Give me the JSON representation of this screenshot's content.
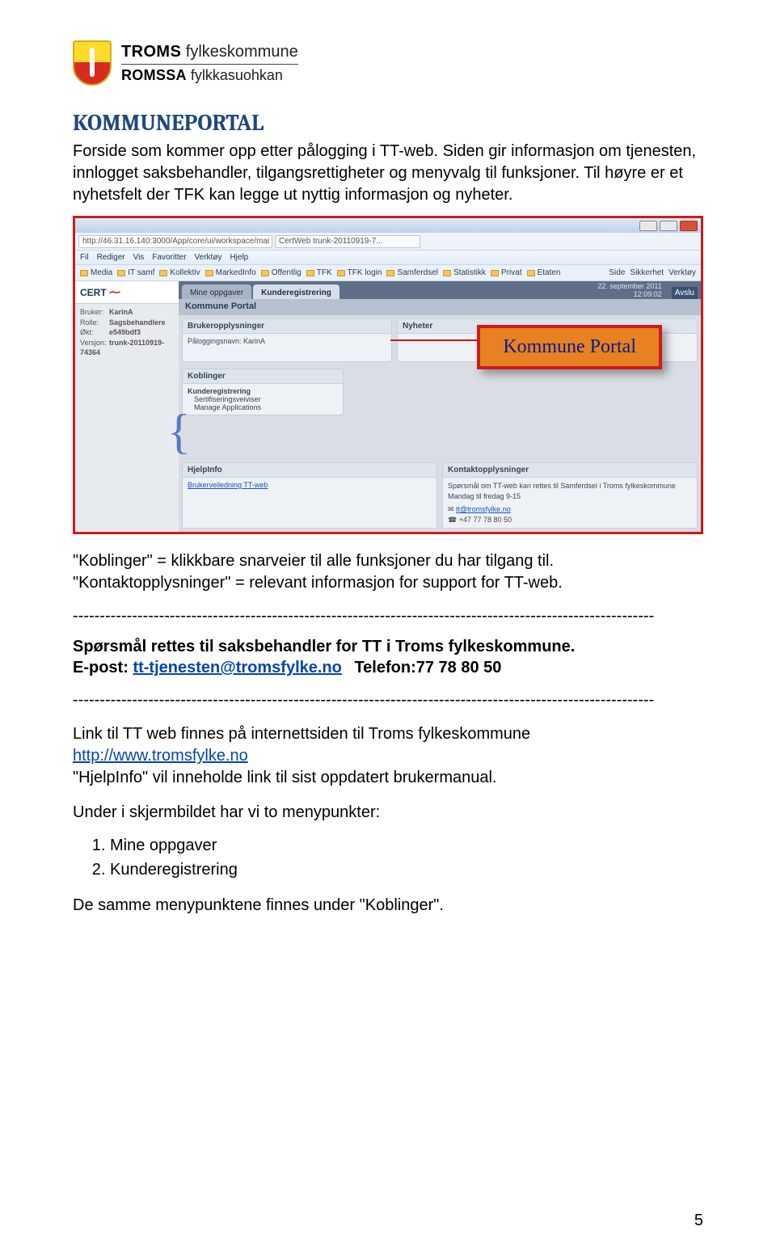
{
  "logo": {
    "line1_bold": "TROMS",
    "line1_rest": " fylkeskommune",
    "line2_bold": "ROMSSA",
    "line2_rest": " fylkkasuohkan"
  },
  "title": "KOMMUNEPORTAL",
  "intro": "Forside som kommer opp etter pålogging i TT-web. Siden gir informasjon om tjenesten, innlogget saksbehandler, tilgangsrettigheter og menyvalg til funksjoner. Til høyre er et nyhetsfelt der TFK kan legge ut nyttig informasjon og nyheter.",
  "browser": {
    "url": "http://46.31.16.140:3000/App/core/ui/workspace/mai",
    "tab_title": "CertWeb trunk-20110919-7...",
    "menus": [
      "Fil",
      "Rediger",
      "Vis",
      "Favoritter",
      "Verktøy",
      "Hjelp"
    ],
    "bookmarks_left": [
      "Media",
      "IT samf",
      "Kollektiv",
      "MarkedInfo",
      "Offentlig",
      "TFK",
      "TFK login",
      "Samferdsel",
      "Statistikk",
      "Privat",
      "Etaten"
    ],
    "bookmarks_right": [
      "Side",
      "Sikkerhet",
      "Verktøy"
    ]
  },
  "cert": {
    "brand": "CERT",
    "user_label": "Bruker:",
    "user": "KarinA",
    "role_label": "Rolle:",
    "role": "Sagsbehandlere",
    "okt_label": "Økt:",
    "okt": "e549bdf3",
    "ver_label": "Versjon:",
    "ver": "trunk-20110919-74364"
  },
  "app": {
    "tabs": [
      "Mine oppgaver",
      "Kunderegistrering"
    ],
    "timestamp": "22. september 2011",
    "time": "12:09:02",
    "avslu": "Avslu",
    "portal_header": "Kommune Portal",
    "panel_brukeropp": "Brukeropplysninger",
    "panel_brukeropp_line": "Påloggingsnavn: KarinA",
    "panel_nyheter": "Nyheter",
    "panel_koblinger": "Koblinger",
    "koblinger_sub": "Kunderegistrering",
    "koblinger_items": [
      "Sertifiseringsveiviser",
      "Manage Applications"
    ],
    "panel_hjelp": "HjelpInfo",
    "hjelp_link": "Brukerveiledning TT-web",
    "panel_kontakt": "Kontaktopplysninger",
    "kontakt_line1": "Spørsmål om TT-web kan rettes til Samferdsel i Troms fylkeskommune",
    "kontakt_line2": "Mandag til fredag 9-15",
    "kontakt_email": "tt@tromsfylke.no",
    "kontakt_tel": "+47 77 78 80 50"
  },
  "callout": "Kommune Portal",
  "mid": {
    "p1": "\"Koblinger\" = klikkbare snarveier til alle funksjoner du har tilgang til.",
    "p2": "\"Kontaktopplysninger\" = relevant informasjon for support for TT-web."
  },
  "dashes": "------------------------------------------------------------------------------------------------------------",
  "support": {
    "line1": "Spørsmål rettes til saksbehandler for TT i Troms fylkeskommune.",
    "email_label": "E-post: ",
    "email": "tt-tjenesten@tromsfylke.no",
    "phone_label": "Telefon:",
    "phone": "77 78 80 50"
  },
  "bottom": {
    "p1a": "Link til TT web finnes på internettsiden til Troms fylkeskommune",
    "link": "http://www.tromsfylke.no",
    "p1b": "\"HjelpInfo\" vil inneholde link til sist oppdatert brukermanual.",
    "p2": "Under i skjermbildet har vi to menypunkter:",
    "items": [
      "Mine oppgaver",
      "Kunderegistrering"
    ],
    "p3": "De samme menypunktene finnes under \"Koblinger\"."
  },
  "page_number": "5"
}
